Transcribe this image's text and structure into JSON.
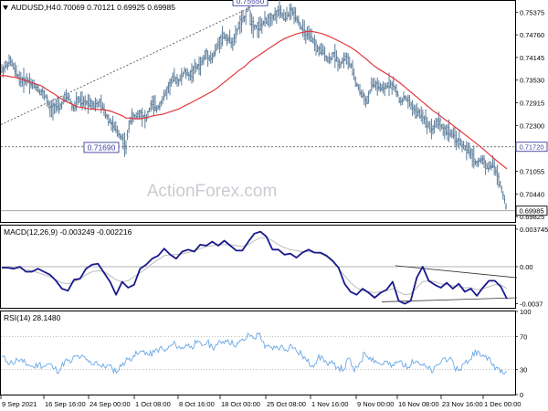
{
  "header": {
    "symbol": "AUDUSD,H4",
    "ohlc": "0.70069 0.70121 0.69925 0.69985",
    "watermark": "ActionForex.com"
  },
  "colors": {
    "bars": "#5b7c9a",
    "sma": "#e0393e",
    "macd": "#1a1a8c",
    "signal": "#bdbdbd",
    "rsi": "#6aa8e6",
    "grid": "#d9d9d9",
    "axis": "#000000",
    "label_box": "#3b3b9e"
  },
  "chart_data": [
    {
      "type": "line",
      "panel": "price",
      "title": "AUDUSD,H4",
      "ylim": [
        0.6968,
        0.7568
      ],
      "y_ticks": [
        "0.75375",
        "0.74760",
        "0.74145",
        "0.73530",
        "0.72915",
        "0.72300",
        "0.71685",
        "0.71055",
        "0.70440",
        "0.69825"
      ],
      "y_tick_values": [
        0.75375,
        0.7476,
        0.74145,
        0.7353,
        0.72915,
        0.723,
        0.71685,
        0.71055,
        0.7044,
        0.69825
      ],
      "x_labels": [
        "9 Sep 2021",
        "16 Sep 16:00",
        "24 Sep 00:00",
        "1 Oct 08:00",
        "8 Oct 16:00",
        "18 Oct 00:00",
        "25 Oct 08:00",
        "1 Nov 16:00",
        "9 Nov 00:00",
        "16 Nov 08:00",
        "23 Nov 16:00",
        "1 Dec 00:00"
      ],
      "price_path_x": [
        0,
        6,
        12,
        18,
        24,
        30,
        36,
        40,
        45,
        50,
        55,
        60,
        65,
        70,
        75,
        80,
        86,
        92,
        98,
        104,
        110,
        116,
        122,
        128,
        134,
        138,
        142,
        148,
        154,
        160,
        166,
        172,
        178,
        184,
        190,
        196,
        202,
        208,
        214,
        220,
        226,
        232,
        238,
        244,
        250,
        256,
        262,
        268,
        272,
        276,
        282,
        288,
        294,
        300,
        306,
        312,
        318,
        324,
        330,
        336,
        342,
        348,
        354,
        360,
        366,
        372,
        378,
        384,
        390,
        396,
        402,
        408,
        414,
        420,
        426,
        432,
        438,
        444,
        450,
        456,
        462,
        468,
        474,
        480,
        486,
        492,
        498,
        504,
        510,
        516,
        522,
        528,
        534,
        540,
        546,
        552,
        555
      ],
      "price_values": [
        0.7375,
        0.739,
        0.7405,
        0.737,
        0.735,
        0.7355,
        0.734,
        0.7335,
        0.732,
        0.731,
        0.727,
        0.7285,
        0.7275,
        0.73,
        0.731,
        0.7275,
        0.73,
        0.729,
        0.7295,
        0.7285,
        0.729,
        0.726,
        0.7235,
        0.7215,
        0.7195,
        0.7169,
        0.7245,
        0.7255,
        0.7265,
        0.7245,
        0.729,
        0.7275,
        0.73,
        0.733,
        0.736,
        0.735,
        0.7375,
        0.7365,
        0.7385,
        0.7395,
        0.7425,
        0.741,
        0.7445,
        0.7475,
        0.7465,
        0.7455,
        0.7505,
        0.752,
        0.7555,
        0.7505,
        0.7495,
        0.7505,
        0.752,
        0.7525,
        0.754,
        0.752,
        0.754,
        0.753,
        0.7495,
        0.7475,
        0.7465,
        0.7435,
        0.743,
        0.7405,
        0.7425,
        0.7395,
        0.7415,
        0.7395,
        0.7345,
        0.7315,
        0.7295,
        0.7345,
        0.7335,
        0.7325,
        0.7345,
        0.7335,
        0.7295,
        0.7305,
        0.7285,
        0.7265,
        0.726,
        0.7235,
        0.722,
        0.7245,
        0.7215,
        0.7215,
        0.7195,
        0.7185,
        0.7165,
        0.7155,
        0.7125,
        0.714,
        0.7115,
        0.7125,
        0.7085,
        0.7035,
        0.6999
      ],
      "sma_values": [
        0.7365,
        0.7365,
        0.7362,
        0.736,
        0.7355,
        0.735,
        0.7345,
        0.7342,
        0.7338,
        0.733,
        0.7322,
        0.7314,
        0.7306,
        0.7298,
        0.7292,
        0.7286,
        0.728,
        0.7278,
        0.7275,
        0.7274,
        0.7273,
        0.7272,
        0.7268,
        0.7262,
        0.7256,
        0.725,
        0.725,
        0.7248,
        0.7248,
        0.7251,
        0.7255,
        0.7258,
        0.726,
        0.7265,
        0.727,
        0.7275,
        0.7283,
        0.729,
        0.7298,
        0.7306,
        0.7314,
        0.7322,
        0.7332,
        0.7344,
        0.7356,
        0.7368,
        0.738,
        0.739,
        0.74,
        0.7408,
        0.7418,
        0.7428,
        0.7438,
        0.7448,
        0.7458,
        0.7466,
        0.7472,
        0.7478,
        0.7482,
        0.7485,
        0.7485,
        0.7482,
        0.7478,
        0.7472,
        0.7465,
        0.7458,
        0.745,
        0.7442,
        0.7432,
        0.742,
        0.7408,
        0.7395,
        0.7384,
        0.7375,
        0.7366,
        0.7356,
        0.7345,
        0.7333,
        0.732,
        0.7308,
        0.7295,
        0.7283,
        0.727,
        0.726,
        0.7248,
        0.7238,
        0.7226,
        0.7215,
        0.7203,
        0.7192,
        0.718,
        0.7168,
        0.7155,
        0.7142,
        0.713,
        0.7118,
        0.7112
      ],
      "annotations": [
        {
          "label": "0.75550",
          "value": 0.7555
        },
        {
          "label": "0.71690",
          "value": 0.7169
        }
      ],
      "horizontal_lines": [
        {
          "label": "0.71720",
          "value": 0.7172,
          "style": "dashed"
        },
        {
          "label": "0.69985",
          "value": 0.69985,
          "style": "solid"
        }
      ],
      "grid": false
    },
    {
      "type": "line",
      "panel": "macd",
      "title": "MACD(12,26,9) -0.003249 -0.002216",
      "ylim": [
        -0.0041,
        0.0041
      ],
      "y_ticks": [
        "0.003745",
        "0.00",
        "-0.0037"
      ],
      "y_tick_values": [
        0.003745,
        0.0,
        -0.0037
      ],
      "macd_values": [
        -0.0001,
        -0.0001,
        -0.0002,
        0.0,
        -0.0005,
        -0.0005,
        -0.0002,
        -0.0005,
        -0.0008,
        -0.0014,
        -0.0022,
        -0.0024,
        -0.0013,
        -0.0012,
        -0.0002,
        0.0002,
        0.0003,
        -0.0006,
        -0.0015,
        -0.0028,
        -0.0015,
        -0.0021,
        -0.0018,
        -0.0002,
        0.0002,
        0.0008,
        0.0011,
        0.0018,
        0.0012,
        0.0008,
        0.0015,
        0.0017,
        0.0015,
        0.0022,
        0.0021,
        0.0025,
        0.0021,
        0.0026,
        0.0021,
        0.0016,
        0.0016,
        0.0025,
        0.0033,
        0.0035,
        0.003,
        0.0017,
        0.0017,
        0.0012,
        0.0013,
        0.0009,
        0.0014,
        0.0017,
        0.0014,
        0.0014,
        0.0011,
        0.0006,
        -0.0001,
        -0.0017,
        -0.0025,
        -0.0028,
        -0.0022,
        -0.0026,
        -0.0031,
        -0.0026,
        -0.0023,
        -0.0015,
        -0.0034,
        -0.0037,
        -0.0034,
        -0.0011,
        0.0,
        -0.0014,
        -0.0018,
        -0.0021,
        -0.0016,
        -0.0022,
        -0.0017,
        -0.0025,
        -0.0022,
        -0.0029,
        -0.0021,
        -0.0014,
        -0.0014,
        -0.002,
        -0.0032
      ],
      "signal_values": [
        0.0,
        -0.0001,
        -0.0001,
        -0.0002,
        -0.0003,
        -0.0004,
        -0.0006,
        -0.0008,
        -0.001,
        -0.0013,
        -0.0016,
        -0.0017,
        -0.0015,
        -0.0012,
        -0.0008,
        -0.0005,
        -0.0004,
        -0.0005,
        -0.0009,
        -0.0013,
        -0.0015,
        -0.0014,
        -0.001,
        -0.0006,
        -0.0002,
        0.0003,
        0.0007,
        0.0011,
        0.0012,
        0.0012,
        0.0013,
        0.0014,
        0.0016,
        0.0018,
        0.002,
        0.0021,
        0.0022,
        0.0022,
        0.0022,
        0.0021,
        0.002,
        0.0022,
        0.0026,
        0.0029,
        0.0029,
        0.0026,
        0.0022,
        0.0019,
        0.0017,
        0.0016,
        0.0015,
        0.0015,
        0.0014,
        0.0013,
        0.001,
        0.0005,
        -0.0002,
        -0.0009,
        -0.0016,
        -0.0021,
        -0.0024,
        -0.0025,
        -0.0026,
        -0.0025,
        -0.0024,
        -0.0022,
        -0.0025,
        -0.0028,
        -0.0027,
        -0.0021,
        -0.0015,
        -0.0014,
        -0.0015,
        -0.0017,
        -0.0018,
        -0.0019,
        -0.002,
        -0.0021,
        -0.0021,
        -0.0023,
        -0.0022,
        -0.002,
        -0.0018,
        -0.0018,
        -0.0022
      ],
      "trendlines": [
        {
          "from": [
            0.0,
            -0.0001
          ],
          "to": [
            1.0,
            -0.0032
          ]
        }
      ],
      "grid": false
    },
    {
      "type": "line",
      "panel": "rsi",
      "title": "RSI(14) 28.1480",
      "ylim": [
        0,
        100
      ],
      "y_ticks": [
        "100",
        "70",
        "30",
        "0"
      ],
      "y_tick_values": [
        100,
        70,
        30,
        0
      ],
      "levels": [
        70,
        30
      ],
      "rsi_values": [
        46,
        40,
        38,
        42,
        39,
        36,
        33,
        37,
        34,
        37,
        31,
        29,
        41,
        38,
        46,
        45,
        42,
        37,
        40,
        33,
        35,
        31,
        28,
        38,
        42,
        47,
        49,
        53,
        47,
        51,
        56,
        52,
        58,
        61,
        55,
        60,
        58,
        62,
        59,
        63,
        57,
        60,
        64,
        66,
        60,
        62,
        65,
        72,
        68,
        74,
        56,
        57,
        56,
        58,
        54,
        60,
        52,
        48,
        40,
        35,
        43,
        45,
        35,
        37,
        33,
        30,
        44,
        27,
        38,
        50,
        45,
        41,
        36,
        40,
        33,
        38,
        40,
        31,
        42,
        40,
        35,
        31,
        28,
        36,
        44,
        43,
        33,
        30,
        38,
        42,
        54,
        46,
        47,
        38,
        33,
        30,
        28
      ],
      "grid": false
    }
  ]
}
